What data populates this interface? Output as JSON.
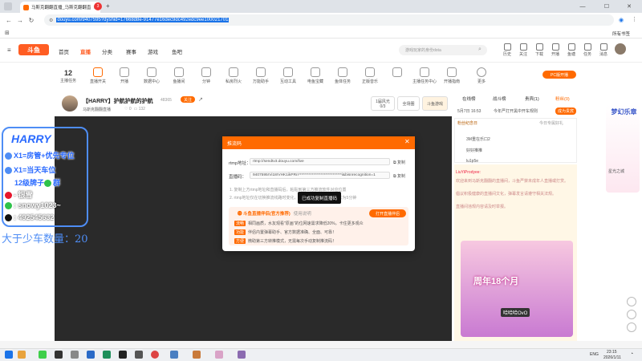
{
  "browser": {
    "tab_title": "马斯克翻翻直播_马斯克翻翻直播",
    "tab_count": "3",
    "url_prefix": "douyu.com/",
    "url_selected": "9407595?dyshid=17668d8e-91477e16dec9dc492edc9ee100021701",
    "bookmarks_label": "所有书签"
  },
  "site": {
    "logo": "斗鱼",
    "nav": [
      "首页",
      "直播",
      "分类",
      "赛事",
      "游戏",
      "鱼吧"
    ],
    "search_placeholder": "游戏玩家的身份dota",
    "top_icons": [
      "历史",
      "关注",
      "下载",
      "开播",
      "鱼塘",
      "任务",
      "消息"
    ],
    "sub_items": [
      "主播任务",
      "直播开关",
      "开播",
      "数据中心",
      "鱼播间",
      "分钟",
      "私房烈火",
      "万能助手",
      "互动工具",
      "电鱼宝藏",
      "鱼体任务",
      "正版音乐",
      "",
      "主播任务中心",
      "开播指南",
      "更多"
    ],
    "sub_count": "12",
    "pc_button": "PC版开播"
  },
  "room": {
    "title": "【HARRY】护航护航的护航",
    "host": "马斯克翻翻直播",
    "level": "48365",
    "follow": "关注",
    "stats": [
      "0",
      "132"
    ],
    "btn_rank": "1届风光",
    "btn_rank_val": "0/3",
    "btn_all": "全场圈",
    "btn_game": "斗鱼游戏"
  },
  "overlay": {
    "title": "HARRY",
    "line1": "X1=房管+优先专位",
    "line2": "X1=当天车位",
    "line3": "12级牌子",
    "line3b": "群",
    "weibo": "- 银雪",
    "wechat": ": snowy1023~",
    "qq": ": 492545632",
    "count_label": "大于少车数量：20"
  },
  "right_panel": {
    "tabs": [
      "在线榜",
      "战斗榜",
      "贵宾(1)",
      "粉丝(0)"
    ],
    "tab_action": "成为贵宾",
    "rows": [
      "5月7日 16:53",
      "今年严打开黑中开车规则",
      "粉丝纪念日",
      "今日专属好礼",
      "3M重在乐口2",
      "好好推推",
      "lu1p5e"
    ],
    "chat_user": "LiuYiProdyee:",
    "chat_lines": [
      "欢迎来到马斯克翻翻的直播间，斗鱼严禁未成年人直播或打赏。",
      "倡议积极健康的直播间文化，弹幕发言请遵守相关法规。",
      "直播间违规内容请及时举报。"
    ],
    "promo_title": "周年18个月",
    "promo_sub": "哈哈哈OvO",
    "ad_text": "梦幻乐章",
    "ad_sub": "星光之城"
  },
  "dialog": {
    "title": "推流码",
    "rtmp_label": "rtmp地址：",
    "rtmp_value": "rtmp://sendtv3.douyu.com/live",
    "key_label": "直播码：",
    "key_value": "9407595rVi18rVHK1ikPRn*****************************i&bisnrecognition=1",
    "copy": "复制",
    "note1": "1. 复制上方rtmp地址和直播码后，粘贴到第三方推流软件对应位置",
    "note2": "2. rtmp地址仅在切换推流线路时变化，直播码每次开播有效时长为5分钟",
    "toast": "已成功复制直播码",
    "promo_title": "斗鱼直播伴侣(官方推荐)",
    "promo_tag": "使用说明",
    "promo_btn": "打开直播伴侣",
    "promo_rows": [
      {
        "tag": "流畅",
        "text": "相同画质，水友观看\"原画\"的位网速需求降低20%，卡住更多观众"
      },
      {
        "tag": "功能",
        "text": "伴侣内置弹幕助手、官方数据准确、全面、可靠！"
      },
      {
        "tag": "方便",
        "text": "微助第三方转推模式，无需每次手动复制推流码！"
      }
    ]
  },
  "taskbar": {
    "lang": "ENG",
    "time": "23:15",
    "date": "2026/1/11"
  }
}
